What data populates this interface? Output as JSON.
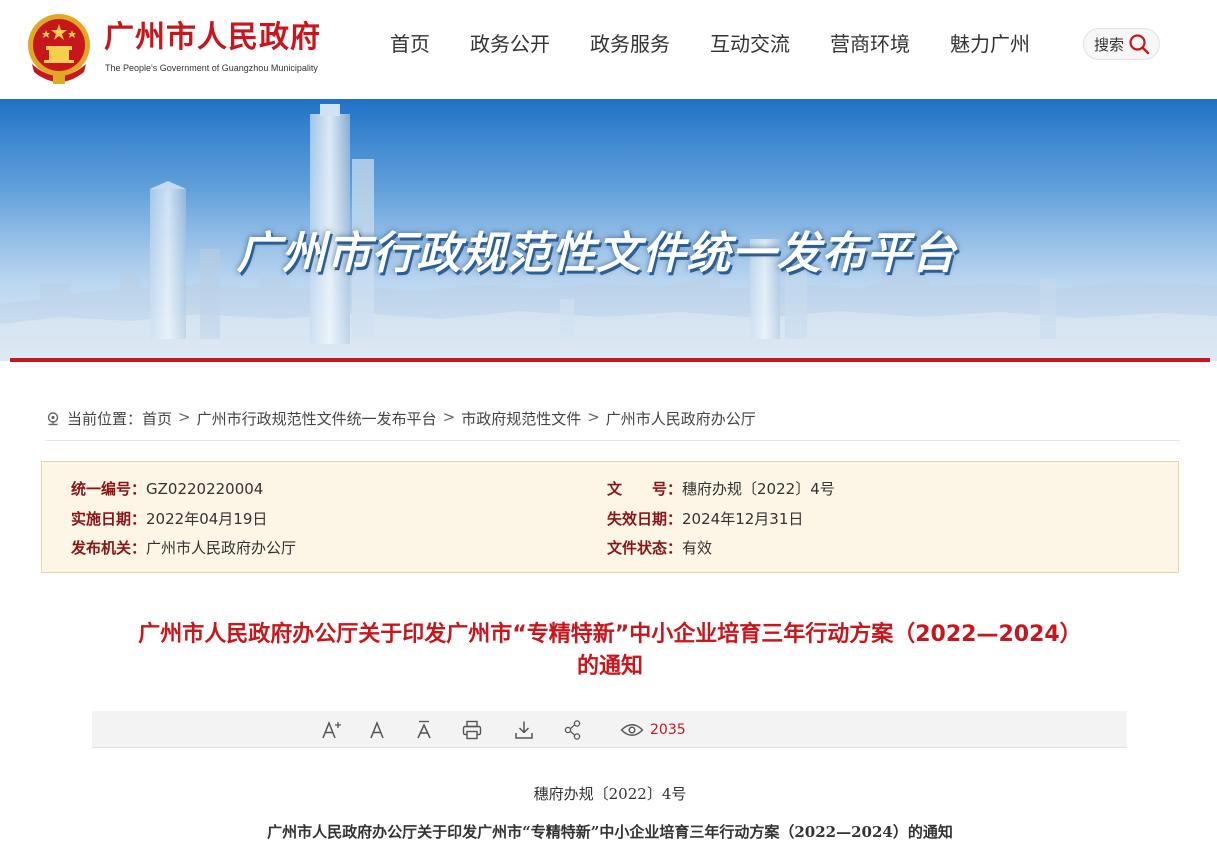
{
  "header": {
    "site_title": "广州市人民政府",
    "site_subtitle": "The People's Government of Guangzhou Municipality",
    "nav": [
      "首页",
      "政务公开",
      "政务服务",
      "互动交流",
      "营商环境",
      "魅力广州"
    ],
    "search_label": "搜索",
    "emblem_icon": "national-emblem-icon",
    "search_icon": "search-icon"
  },
  "banner": {
    "title": "广州市行政规范性文件统一发布平台"
  },
  "breadcrumb": {
    "prefix": "当前位置：",
    "items": [
      "首页",
      "广州市行政规范性文件统一发布平台",
      "市政府规范性文件",
      "广州市人民政府办公厅"
    ],
    "separator": ">",
    "icon": "location-pin-icon"
  },
  "info": {
    "serial_label": "统一编号：",
    "serial_value": "GZ0220220004",
    "doc_no_label": "文　　号：",
    "doc_no_value": "穗府办规〔2022〕4号",
    "effective_label": "实施日期：",
    "effective_value": "2022年04月19日",
    "expiry_label": "失效日期：",
    "expiry_value": "2024年12月31日",
    "issuer_label": "发布机关：",
    "issuer_value": "广州市人民政府办公厅",
    "status_label": "文件状态：",
    "status_value": "有效"
  },
  "document": {
    "title_line1": "广州市人民政府办公厅关于印发广州市“专精特新”中小企业培育三年行动方案（2022—2024）",
    "title_line2": "的通知",
    "number": "穗府办规〔2022〕4号",
    "subtitle": "广州市人民政府办公厅关于印发广州市“专精特新”中小企业培育三年行动方案（2022—2024）的通知"
  },
  "toolbar": {
    "view_count": "2035",
    "icons": [
      "font-increase-icon",
      "font-reset-icon",
      "font-decrease-icon",
      "print-icon",
      "download-icon",
      "share-icon",
      "eye-icon"
    ]
  },
  "colors": {
    "brand_red": "#c8161d",
    "label_dark_red": "#8a1416",
    "info_bg": "#fdf5e6",
    "info_border": "#ebd5a3"
  }
}
